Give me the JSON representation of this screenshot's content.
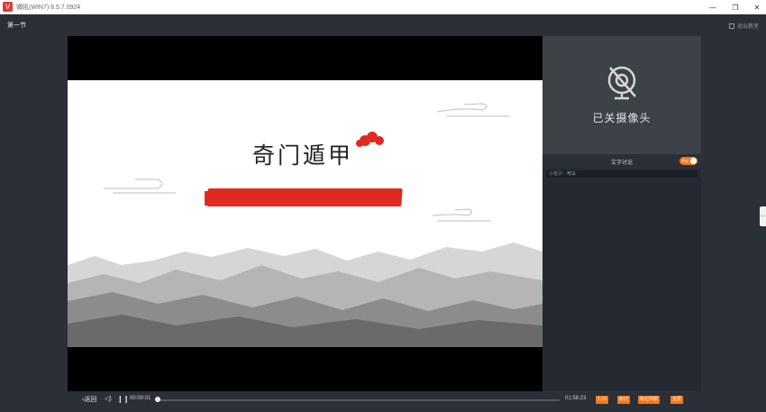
{
  "titlebar": {
    "logo_glyph": "V",
    "title": "微吼(WIN7) 8.5.7.0924",
    "minimize": "—",
    "restore": "❐",
    "close": "✕"
  },
  "topbar": {
    "lesson_name": "第一节",
    "exit_label": "退出教室"
  },
  "slide": {
    "title": "奇门遁甲"
  },
  "camera": {
    "status_text": "已关摄像头"
  },
  "chat": {
    "title": "文字讨论",
    "toggle_label": "开启",
    "messages": [
      {
        "user": "小桔子：",
        "text": "可以"
      }
    ]
  },
  "rail": {
    "tab_glyph": "‹ ›"
  },
  "controls": {
    "back_label": "‹返回",
    "volume_glyph": "◁)",
    "pause_glyph": "❙❙",
    "current_time": "00:00:01",
    "total_time": "01:58:23",
    "progress": 0.005,
    "buttons": [
      "1.0X",
      "标记",
      "标记列表",
      "全屏"
    ]
  },
  "colors": {
    "accent": "#f07a1a",
    "brush_red": "#e02a1f",
    "background": "#2a2f38"
  }
}
